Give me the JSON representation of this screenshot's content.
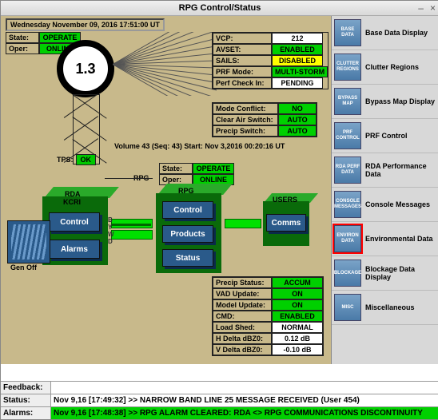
{
  "window": {
    "title": "RPG Control/Status"
  },
  "datetime": "Wednesday November 09, 2016   17:51:00 UT",
  "rda_state": {
    "state_k": "State:",
    "state_v": "OPERATE",
    "oper_k": "Oper:",
    "oper_v": "ONLINE"
  },
  "elev": "1.3",
  "tps": {
    "label": "TPS:",
    "value": "OK"
  },
  "volume": "Volume 43 (Seq: 43) Start: Nov 3,2016   00:20:16 UT",
  "rpg_state": {
    "state_k": "State:",
    "state_v": "OPERATE",
    "oper_k": "Oper:",
    "oper_v": "ONLINE"
  },
  "vcp_table": [
    {
      "k": "VCP:",
      "v": "212",
      "bg": "#fff"
    },
    {
      "k": "AVSET:",
      "v": "ENABLED",
      "bg": "#00d000"
    },
    {
      "k": "SAILS:",
      "v": "DISABLED",
      "bg": "#ffff00"
    },
    {
      "k": "PRF Mode:",
      "v": "MULTI-STORM",
      "bg": "#00d000"
    },
    {
      "k": "Perf Check In:",
      "v": "PENDING",
      "bg": "#fff"
    }
  ],
  "mode_table": [
    {
      "k": "Mode Conflict:",
      "v": "NO",
      "bg": "#00d000"
    },
    {
      "k": "Clear Air Switch:",
      "v": "AUTO",
      "bg": "#00d000"
    },
    {
      "k": "Precip Switch:",
      "v": "AUTO",
      "bg": "#00d000"
    }
  ],
  "precip_table": [
    {
      "k": "Precip Status:",
      "v": "ACCUM",
      "bg": "#00d000"
    },
    {
      "k": "VAD Update:",
      "v": "ON",
      "bg": "#00d000"
    },
    {
      "k": "Model Update:",
      "v": "ON",
      "bg": "#00d000"
    },
    {
      "k": "CMD:",
      "v": "ENABLED",
      "bg": "#00d000"
    },
    {
      "k": "Load Shed:",
      "v": "NORMAL",
      "bg": "#fff"
    },
    {
      "k": "H Delta dBZ0:",
      "v": "0.12 dB",
      "bg": "#fff"
    },
    {
      "k": "V Delta dBZ0:",
      "v": "-0.10 dB",
      "bg": "#fff"
    }
  ],
  "rda_box": {
    "title1": "RDA",
    "title2": "KCRI",
    "btn1": "Control",
    "btn2": "Alarms"
  },
  "rpg_box": {
    "title": "RPG",
    "rpglabel": "RPG",
    "btn1": "Control",
    "btn2": "Products",
    "btn3": "Status"
  },
  "users_box": {
    "title": "USERS",
    "btn1": "Comms"
  },
  "gen": "Gen Off",
  "bywd": {
    "b": "B",
    "y": "Y",
    "w": "W",
    "d": "D"
  },
  "sidebar": [
    {
      "icon": "BASE DATA",
      "label": "Base Data Display",
      "name": "base-data"
    },
    {
      "icon": "CLUTTER REGIONS",
      "label": "Clutter Regions",
      "name": "clutter-regions"
    },
    {
      "icon": "BYPASS MAP",
      "label": "Bypass Map Display",
      "name": "bypass-map"
    },
    {
      "icon": "PRF CONTROL",
      "label": "PRF Control",
      "name": "prf-control"
    },
    {
      "icon": "RDA PERF DATA",
      "label": "RDA Performance Data",
      "name": "rda-perf"
    },
    {
      "icon": "CONSOLE MESSAGES",
      "label": "Console Messages",
      "name": "console-msgs"
    },
    {
      "icon": "ENVIRON DATA",
      "label": "Environmental Data",
      "name": "env-data",
      "hl": true
    },
    {
      "icon": "BLOCKAGE",
      "label": "Blockage Data Display",
      "name": "blockage"
    },
    {
      "icon": "MISC",
      "label": "Miscellaneous",
      "name": "misc"
    }
  ],
  "bottom": {
    "feedback_k": "Feedback:",
    "feedback_v": "",
    "status_k": "Status:",
    "status_v": "Nov 9,16 [17:49:32] >> NARROW BAND LINE 25 MESSAGE RECEIVED (User 454)",
    "alarms_k": "Alarms:",
    "alarms_v": "Nov 9,16 [17:48:38] >> RPG ALARM CLEARED: RDA <> RPG COMMUNICATIONS DISCONTINUITY"
  }
}
